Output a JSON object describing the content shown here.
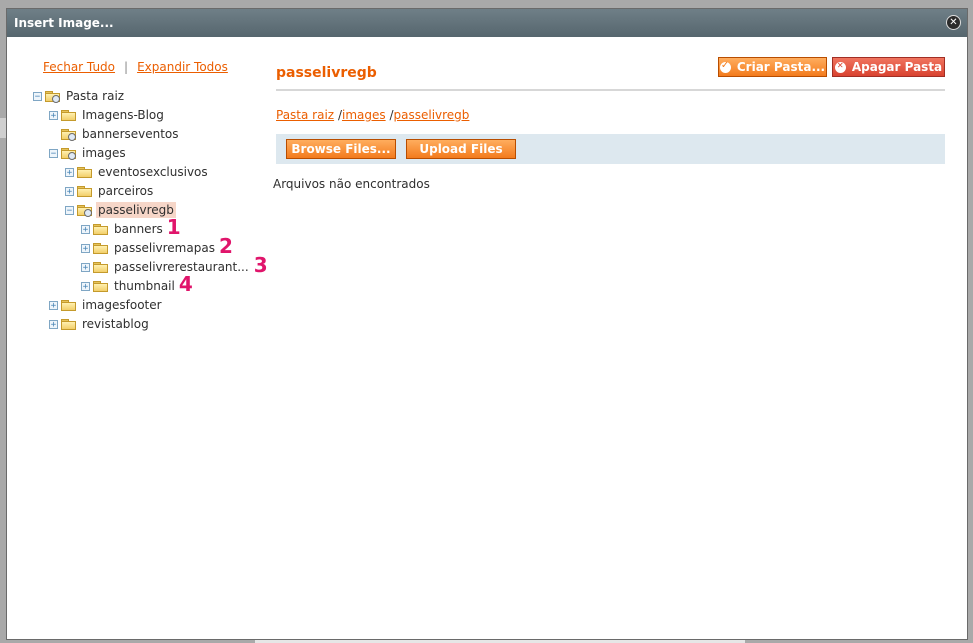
{
  "dialog": {
    "title": "Insert Image..."
  },
  "tree_links": {
    "collapse_all": "Fechar Tudo",
    "separator": "|",
    "expand_all": "Expandir Todos"
  },
  "tree": [
    {
      "label": "Pasta raiz",
      "toggle": "−",
      "level": 0,
      "open": true
    },
    {
      "label": "Imagens-Blog",
      "toggle": "+",
      "level": 1
    },
    {
      "label": "bannerseventos",
      "toggle": "",
      "level": 1,
      "open": true
    },
    {
      "label": "images",
      "toggle": "−",
      "level": 1,
      "open": true
    },
    {
      "label": "eventosexclusivos",
      "toggle": "+",
      "level": 2
    },
    {
      "label": "parceiros",
      "toggle": "+",
      "level": 2
    },
    {
      "label": "passelivregb",
      "toggle": "−",
      "level": 2,
      "open": true,
      "selected": true
    },
    {
      "label": "banners",
      "toggle": "+",
      "level": 3,
      "marker": "1"
    },
    {
      "label": "passelivremapas",
      "toggle": "+",
      "level": 3,
      "marker": "2"
    },
    {
      "label": "passelivrerestaurant...",
      "toggle": "+",
      "level": 3,
      "marker": "3"
    },
    {
      "label": "thumbnail",
      "toggle": "+",
      "level": 3,
      "marker": "4"
    },
    {
      "label": "imagesfooter",
      "toggle": "+",
      "level": 1
    },
    {
      "label": "revistablog",
      "toggle": "+",
      "level": 1
    }
  ],
  "content": {
    "title": "passelivregb",
    "create_folder": "Criar Pasta...",
    "delete_folder": "Apagar Pasta",
    "breadcrumb": [
      "Pasta raiz",
      "images",
      "passelivregb"
    ],
    "breadcrumb_sep": "/",
    "browse_files": "Browse Files...",
    "upload_files": "Upload Files",
    "status": "Arquivos não encontrados"
  },
  "colors": {
    "accent": "#eb5e00",
    "button": "#f37b1d",
    "delete": "#d94330",
    "selection": "#f6d6c8",
    "marker": "#e0156b"
  }
}
